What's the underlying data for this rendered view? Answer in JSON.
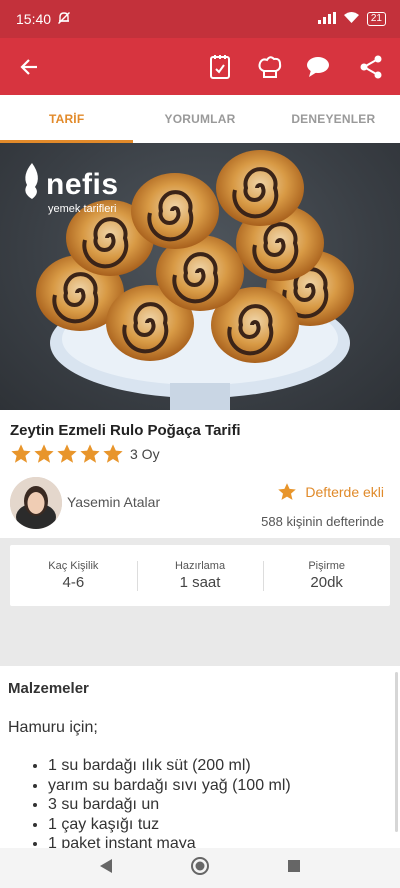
{
  "status_bar": {
    "time": "15:40",
    "battery": "21"
  },
  "app_bar": {
    "icons": [
      "back-arrow-icon",
      "notebook-icon",
      "chef-hat-icon",
      "comment-icon",
      "share-icon"
    ]
  },
  "tabs": [
    {
      "label": "TARİF",
      "active": true
    },
    {
      "label": "YORUMLAR",
      "active": false
    },
    {
      "label": "DENEYENLER",
      "active": false
    }
  ],
  "hero": {
    "logo_main": "nefis",
    "logo_sub": "yemek tarifleri"
  },
  "recipe": {
    "title": "Zeytin Ezmeli Rulo Poğaça Tarifi",
    "rating_stars": 5,
    "rating_text": "3 Oy",
    "author": "Yasemin Atalar",
    "saved_label": "Defterde ekli",
    "saved_count": "588 kişinin defterinde"
  },
  "stats": [
    {
      "label": "Kaç Kişilik",
      "value": "4-6"
    },
    {
      "label": "Hazırlama",
      "value": "1 saat"
    },
    {
      "label": "Pişirme",
      "value": "20dk"
    }
  ],
  "ingredients": {
    "title": "Malzemeler",
    "section": "Hamuru için;",
    "items": [
      "1 su bardağı ılık süt (200 ml)",
      "yarım su bardağı sıvı yağ (100 ml)",
      "3 su bardağı un",
      "1 çay kaşığı tuz",
      "1 paket instant maya"
    ]
  },
  "colors": {
    "primary": "#d7343f",
    "status": "#c3313b",
    "accent": "#e28a2a"
  }
}
